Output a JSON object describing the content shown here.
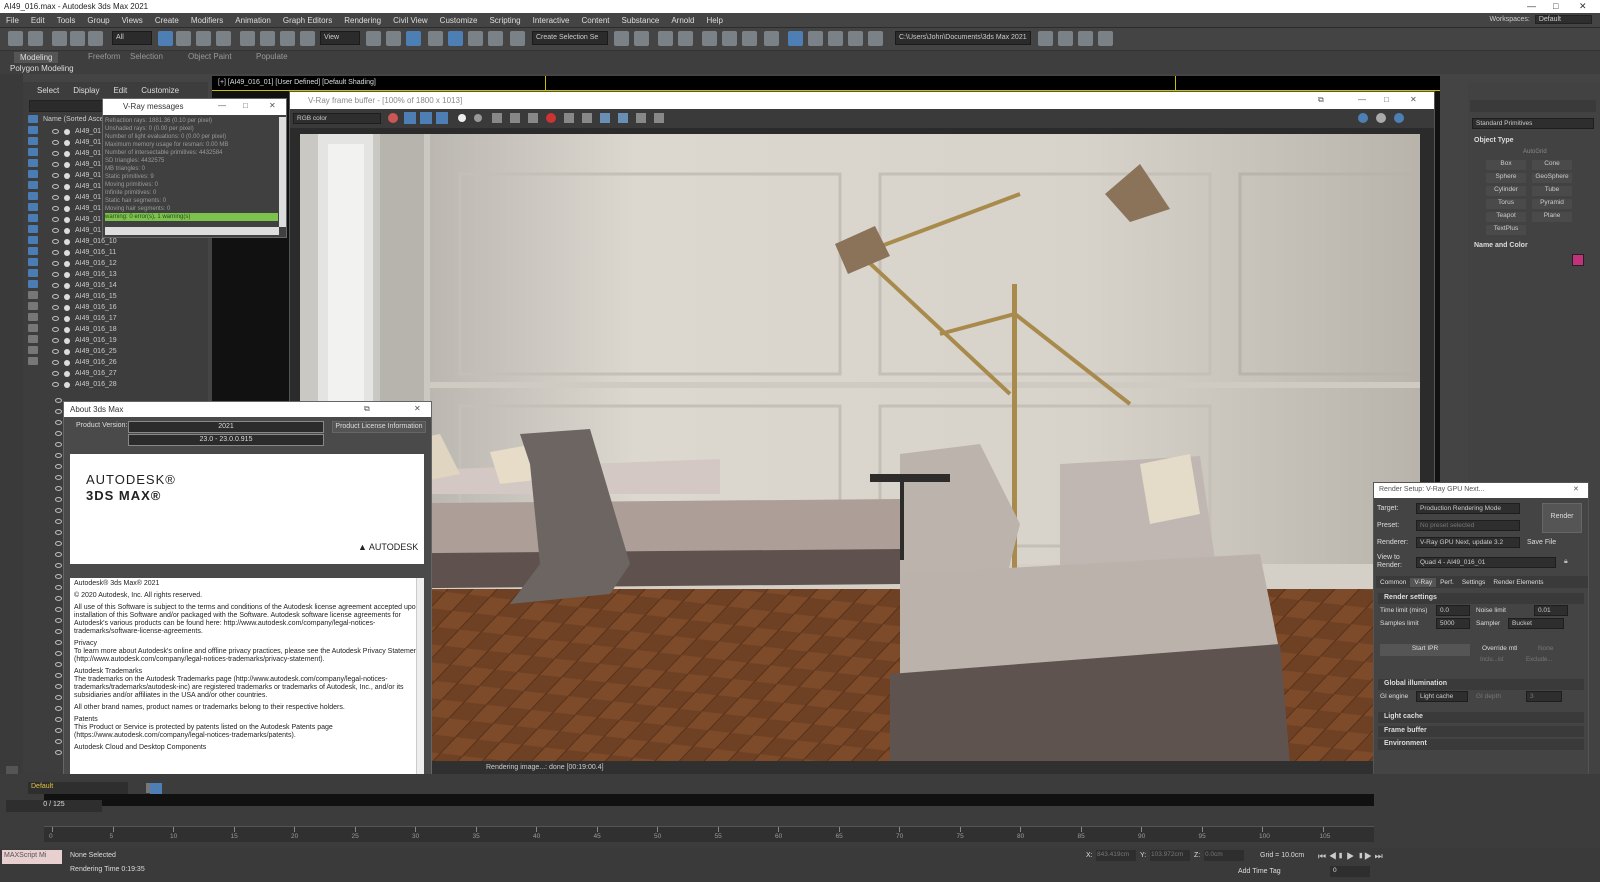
{
  "window": {
    "title": "AI49_016.max - Autodesk 3ds Max 2021",
    "controls": [
      "—",
      "□",
      "✕"
    ]
  },
  "menu": [
    "File",
    "Edit",
    "Tools",
    "Group",
    "Views",
    "Create",
    "Modifiers",
    "Animation",
    "Graph Editors",
    "Rendering",
    "Civil View",
    "Customize",
    "Scripting",
    "Interactive",
    "Content",
    "Substance",
    "Arnold",
    "Help"
  ],
  "workspace": {
    "label": "Workspaces:",
    "value": "Default"
  },
  "toolbar": {
    "selection_filter": "All",
    "ref_coord": "View",
    "named_selection": "Create Selection Se",
    "project_path": "C:\\Users\\John\\Documents\\3ds Max 2021"
  },
  "ribbon": {
    "tabs": [
      "Modeling",
      "Freeform",
      "Selection",
      "Object Paint",
      "Populate"
    ],
    "active": "Modeling",
    "subtab": "Polygon Modeling"
  },
  "scene_explorer": {
    "menu": [
      "Select",
      "Display",
      "Edit",
      "Customize"
    ],
    "column": "Name (Sorted Ascen",
    "items": [
      "AI49_01",
      "AI49_01",
      "AI49_01",
      "AI49_01",
      "AI49_01",
      "AI49_01",
      "AI49_01",
      "AI49_01",
      "AI49_01",
      "AI49_01",
      "AI49_016_10",
      "AI49_016_11",
      "AI49_016_12",
      "AI49_016_13",
      "AI49_016_14",
      "AI49_016_15",
      "AI49_016_16",
      "AI49_016_17",
      "AI49_016_18",
      "AI49_016_19",
      "AI49_016_25",
      "AI49_016_26",
      "AI49_016_27",
      "AI49_016_28"
    ]
  },
  "viewport": {
    "label": "[+] [AI49_016_01] [User Defined] [Default Shading]"
  },
  "vray_messages": {
    "title": "V-Ray messages",
    "lines": [
      "Refraction rays: 1881.36 (0.10 per pixel)",
      "Unshaded rays: 0 (0.00 per pixel)",
      "Number of light evaluations: 0 (0.00 per pixel)",
      "Maximum memory usage for resman: 0.00 MB",
      "Number of intersectable primitives: 4432584",
      "SD triangles: 4432575",
      "MB triangles: 0",
      "Static primitives: 9",
      "Moving primitives: 0",
      "Infinite primitives: 0",
      "Static hair segments: 0",
      "Moving hair segments: 0"
    ],
    "warning": "warning: 0 error(s), 1 warning(s)"
  },
  "vfb": {
    "title": "V-Ray frame buffer - [100% of 1800 x 1013]",
    "channel": "RGB color",
    "status": "Rendering image...: done [00:19:00.4]"
  },
  "about": {
    "title": "About 3ds Max",
    "version_label": "Product Version:",
    "version": "2021",
    "build": "23.0 - 23.0.0.915",
    "license_btn": "Product License Information",
    "logo_line1": "AUTODESK®",
    "logo_line2": "3DS MAX®",
    "brand": "AUTODESK",
    "text": [
      "Autodesk® 3ds Max® 2021",
      "© 2020 Autodesk, Inc.  All rights reserved.",
      "All use of this Software is subject to the terms and conditions of the Autodesk license agreement accepted upon installation of this Software and/or packaged with the Software.  Autodesk software license agreements for Autodesk's various products can be found here: http://www.autodesk.com/company/legal-notices-trademarks/software-license-agreements.",
      "Privacy\nTo learn more about Autodesk's online and offline privacy practices, please see the Autodesk Privacy Statement (http://www.autodesk.com/company/legal-notices-trademarks/privacy-statement).",
      "Autodesk Trademarks\nThe trademarks on the Autodesk Trademarks page (http://www.autodesk.com/company/legal-notices-trademarks/trademarks/autodesk-inc) are registered trademarks or trademarks of Autodesk, Inc., and/or its subsidiaries and/or affiliates in the USA and/or other countries.",
      "All other brand names, product names or trademarks belong to their respective holders.",
      "Patents\nThis Product or Service is protected by patents listed on the Autodesk Patents page (https://www.autodesk.com/company/legal-notices-trademarks/patents).",
      "Autodesk Cloud and Desktop Components"
    ]
  },
  "render_setup": {
    "title": "Render Setup: V-Ray GPU Next...",
    "target_label": "Target:",
    "target": "Production Rendering Mode",
    "preset_label": "Preset:",
    "preset": "No preset selected",
    "renderer_label": "Renderer:",
    "renderer": "V-Ray GPU Next, update 3.2",
    "save_file": "Save File",
    "view_label": "View to Render:",
    "view": "Quad 4 - AI49_016_01",
    "render_btn": "Render",
    "tabs": [
      "Common",
      "V-Ray",
      "Perf.",
      "Settings",
      "Render Elements"
    ],
    "render_settings": "Render settings",
    "time_limit_label": "Time limit (mins)",
    "time_limit": "0.0",
    "noise_limit_label": "Noise limit",
    "noise_limit": "0.01",
    "samples_limit_label": "Samples limit",
    "samples_limit": "5000",
    "sampler_label": "Sampler",
    "sampler": "Bucket",
    "start_ipr": "Start IPR",
    "override_mtl": "Override mtl",
    "override_none": "None",
    "include": "Inclu...ist",
    "exclude": "Exclude...",
    "gi": "Global illumination",
    "gi_engine_label": "GI engine",
    "gi_engine": "Light cache",
    "gi_depth_label": "GI depth",
    "gi_depth": "3",
    "sections": [
      "Light cache",
      "Frame buffer",
      "Environment"
    ]
  },
  "command_panel": {
    "category": "Standard Primitives",
    "object_type": "Object Type",
    "autogrid": "AutoGrid",
    "primitives": [
      "Box",
      "Cone",
      "Sphere",
      "GeoSphere",
      "Cylinder",
      "Tube",
      "Torus",
      "Pyramid",
      "Teapot",
      "Plane",
      "TextPlus"
    ],
    "name_color": "Name and Color",
    "swatch": "#c2327a"
  },
  "timeline": {
    "layer": "Default",
    "frame": "0 / 125",
    "ticks": [
      "0",
      "5",
      "10",
      "15",
      "20",
      "25",
      "30",
      "35",
      "40",
      "45",
      "50",
      "55",
      "60",
      "65",
      "70",
      "75",
      "80",
      "85",
      "90",
      "95",
      "100",
      "105"
    ],
    "status1": "None Selected",
    "status2": "Rendering Time  0:19:35",
    "maxscript": "MAXScript Mi",
    "x_label": "X:",
    "x": "843.419cm",
    "y_label": "Y:",
    "y": "103.972cm",
    "z_label": "Z:",
    "z": "0.0cm",
    "grid": "Grid = 10.0cm",
    "add_time_tag": "Add Time Tag",
    "frame_field": "0"
  },
  "colors": {
    "accent": "#4e7fb4",
    "warning_bar": "#7dc24d",
    "viewport_border": "#c8c000"
  }
}
